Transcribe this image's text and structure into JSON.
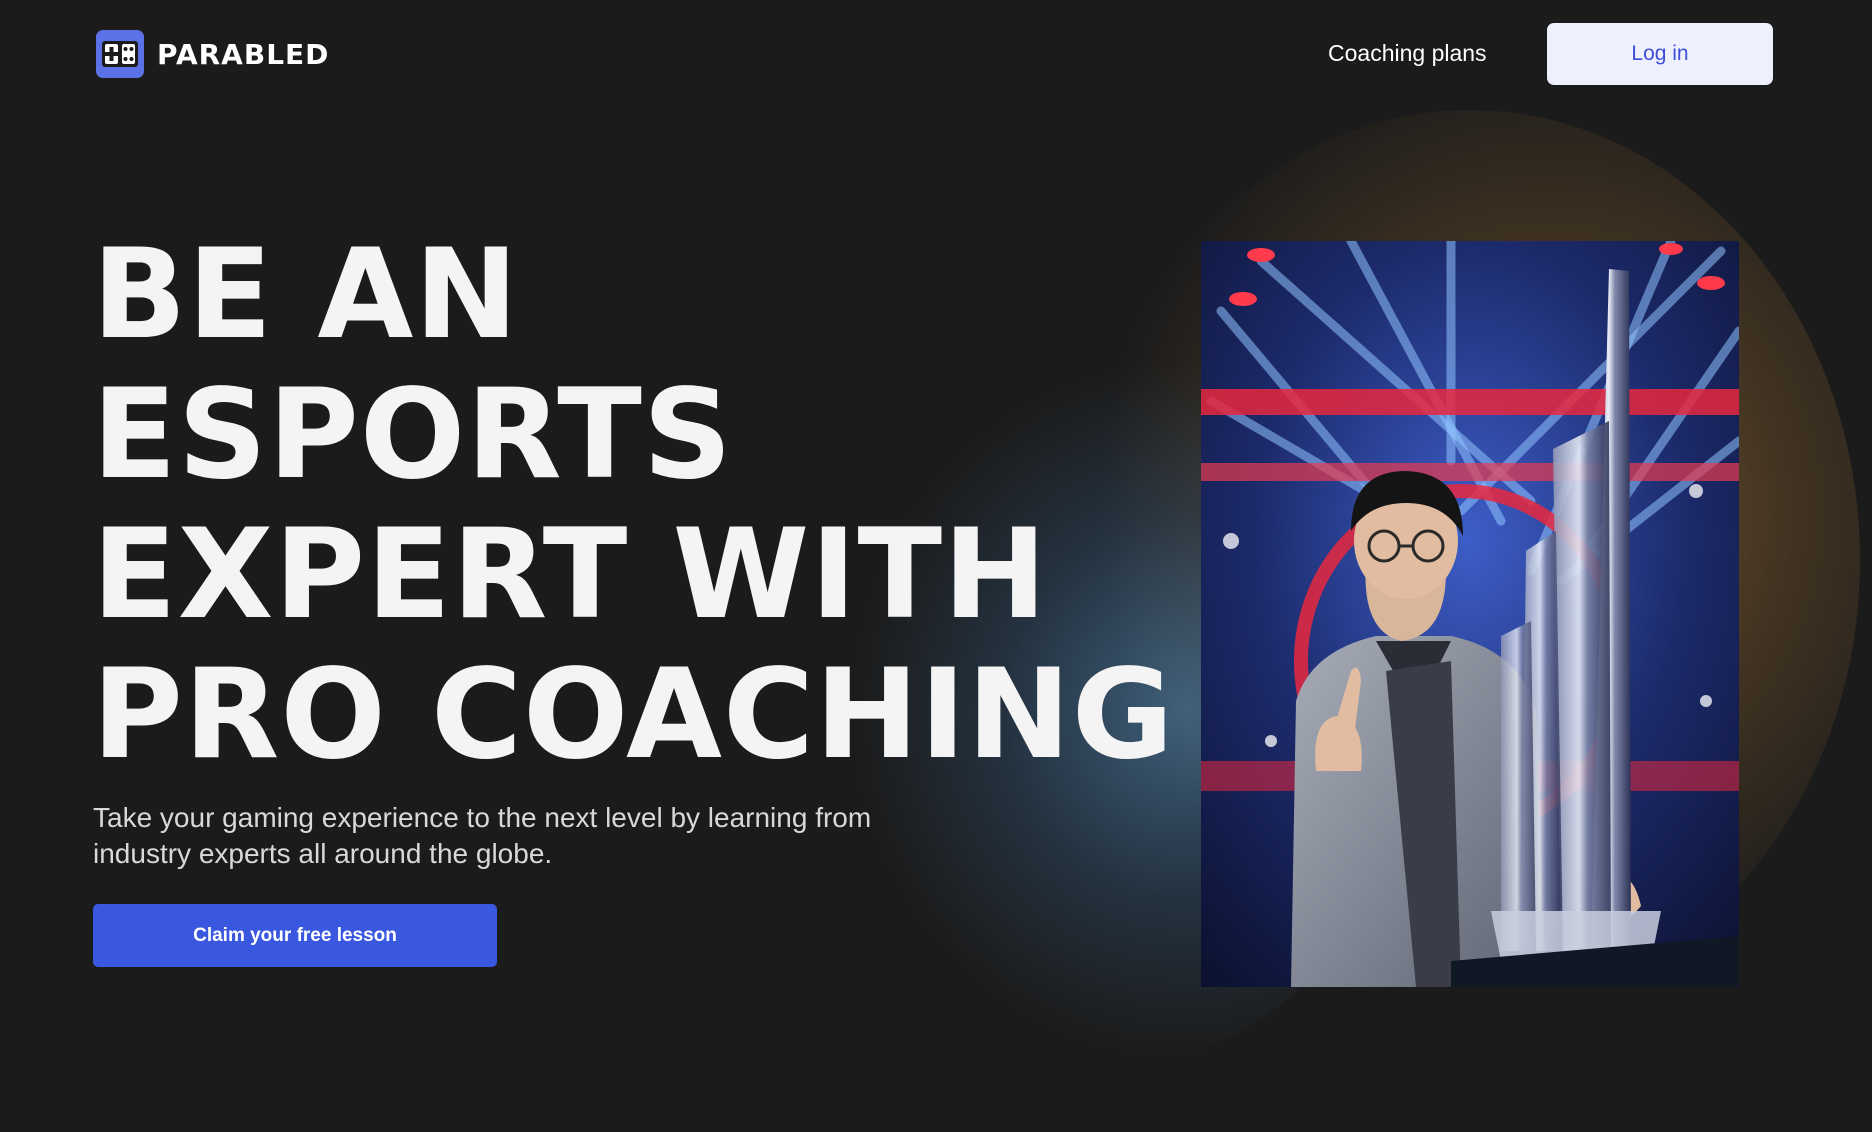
{
  "brand": {
    "name": "PARABLED",
    "icon": "gamepad-icon"
  },
  "nav": {
    "coaching_plans": "Coaching plans",
    "login": "Log in"
  },
  "hero": {
    "headline_lines": [
      "BE AN",
      "ESPORTS",
      "EXPERT WITH",
      "PRO COACHING"
    ],
    "subtext": "Take your gaming experience to the next level by learning from industry experts all around the globe.",
    "cta": "Claim your free lesson",
    "image": "esports-champion-with-trophy-photo"
  },
  "colors": {
    "background": "#1b1b1b",
    "accent": "#3a57e0",
    "login_bg": "#eef0fd",
    "login_text": "#3d4fd6",
    "logo_bg": "#5b72e6"
  }
}
